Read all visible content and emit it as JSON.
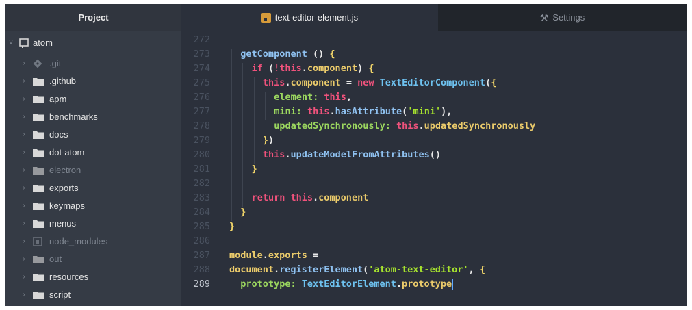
{
  "sidebar": {
    "title": "Project",
    "root": {
      "label": "atom",
      "icon": "repo-icon"
    },
    "items": [
      {
        "label": ".git",
        "icon": "git-icon",
        "dim": true
      },
      {
        "label": ".github",
        "icon": "folder-icon",
        "dim": false
      },
      {
        "label": "apm",
        "icon": "folder-icon",
        "dim": false
      },
      {
        "label": "benchmarks",
        "icon": "folder-icon",
        "dim": false
      },
      {
        "label": "docs",
        "icon": "folder-icon",
        "dim": false
      },
      {
        "label": "dot-atom",
        "icon": "folder-icon",
        "dim": false
      },
      {
        "label": "electron",
        "icon": "folder-icon",
        "dim": true
      },
      {
        "label": "exports",
        "icon": "folder-icon",
        "dim": false
      },
      {
        "label": "keymaps",
        "icon": "folder-icon",
        "dim": false
      },
      {
        "label": "menus",
        "icon": "folder-icon",
        "dim": false
      },
      {
        "label": "node_modules",
        "icon": "submodule-icon",
        "dim": true
      },
      {
        "label": "out",
        "icon": "folder-icon",
        "dim": true
      },
      {
        "label": "resources",
        "icon": "folder-icon",
        "dim": false
      },
      {
        "label": "script",
        "icon": "folder-icon",
        "dim": false
      }
    ]
  },
  "tabs": [
    {
      "label": "text-editor-element.js",
      "icon": "js-file-icon",
      "active": true
    },
    {
      "label": "Settings",
      "icon": "tools-icon",
      "active": false
    }
  ],
  "editor": {
    "current_line": "289",
    "lines": [
      {
        "n": "272",
        "tokens": []
      },
      {
        "n": "273",
        "tokens": [
          [
            "fn",
            "getComponent"
          ],
          [
            "pl",
            " () "
          ],
          [
            "br",
            "{"
          ]
        ]
      },
      {
        "n": "274",
        "tokens": [
          [
            "kw",
            "if"
          ],
          [
            "pl",
            " ("
          ],
          [
            "kw",
            "!"
          ],
          [
            "th",
            "this"
          ],
          [
            "pl",
            "."
          ],
          [
            "pr",
            "component"
          ],
          [
            "pl",
            ") "
          ],
          [
            "br",
            "{"
          ]
        ]
      },
      {
        "n": "275",
        "tokens": [
          [
            "th",
            "this"
          ],
          [
            "pl",
            "."
          ],
          [
            "pr",
            "component"
          ],
          [
            "pl",
            " = "
          ],
          [
            "kw",
            "new"
          ],
          [
            "pl",
            " "
          ],
          [
            "cls",
            "TextEditorComponent"
          ],
          [
            "pl",
            "("
          ],
          [
            "br",
            "{"
          ]
        ]
      },
      {
        "n": "276",
        "tokens": [
          [
            "gr",
            "element:"
          ],
          [
            "pl",
            " "
          ],
          [
            "th",
            "this"
          ],
          [
            "pl",
            ","
          ]
        ]
      },
      {
        "n": "277",
        "tokens": [
          [
            "gr",
            "mini:"
          ],
          [
            "pl",
            " "
          ],
          [
            "th",
            "this"
          ],
          [
            "pl",
            "."
          ],
          [
            "fn",
            "hasAttribute"
          ],
          [
            "pl",
            "("
          ],
          [
            "str",
            "'mini'"
          ],
          [
            "pl",
            "),"
          ]
        ]
      },
      {
        "n": "278",
        "tokens": [
          [
            "gr",
            "updatedSynchronously:"
          ],
          [
            "pl",
            " "
          ],
          [
            "th",
            "this"
          ],
          [
            "pl",
            "."
          ],
          [
            "pr",
            "updatedSynchronously"
          ]
        ]
      },
      {
        "n": "279",
        "tokens": [
          [
            "br",
            "}"
          ],
          [
            "pl",
            ")"
          ]
        ]
      },
      {
        "n": "280",
        "tokens": [
          [
            "th",
            "this"
          ],
          [
            "pl",
            "."
          ],
          [
            "fn",
            "updateModelFromAttributes"
          ],
          [
            "pl",
            "()"
          ]
        ]
      },
      {
        "n": "281",
        "tokens": [
          [
            "br",
            "}"
          ]
        ]
      },
      {
        "n": "282",
        "tokens": []
      },
      {
        "n": "283",
        "tokens": [
          [
            "kw",
            "return"
          ],
          [
            "pl",
            " "
          ],
          [
            "th",
            "this"
          ],
          [
            "pl",
            "."
          ],
          [
            "pr",
            "component"
          ]
        ]
      },
      {
        "n": "284",
        "tokens": [
          [
            "br",
            "}"
          ]
        ]
      },
      {
        "n": "285",
        "tokens": [
          [
            "br",
            "}"
          ]
        ]
      },
      {
        "n": "286",
        "tokens": []
      },
      {
        "n": "287",
        "tokens": [
          [
            "pr",
            "module"
          ],
          [
            "pl",
            "."
          ],
          [
            "pr",
            "exports"
          ],
          [
            "pl",
            " ="
          ]
        ]
      },
      {
        "n": "288",
        "tokens": [
          [
            "pr",
            "document"
          ],
          [
            "pl",
            "."
          ],
          [
            "fn",
            "registerElement"
          ],
          [
            "pl",
            "("
          ],
          [
            "str",
            "'atom-text-editor'"
          ],
          [
            "pl",
            ", "
          ],
          [
            "br",
            "{"
          ]
        ]
      },
      {
        "n": "289",
        "tokens": [
          [
            "gr",
            "prototype:"
          ],
          [
            "pl",
            " "
          ],
          [
            "cls",
            "TextEditorElement"
          ],
          [
            "pl",
            "."
          ],
          [
            "pr",
            "prototype"
          ]
        ]
      }
    ]
  },
  "colors": {
    "sidebar_bg": "#353b45",
    "editor_bg": "#2b303b",
    "tabbar_bg": "#21252b",
    "keyword": "#f0527c",
    "function": "#8fc1f0",
    "property": "#ebcb6b",
    "string": "#a6e22e",
    "cursor": "#5fa8ff"
  }
}
